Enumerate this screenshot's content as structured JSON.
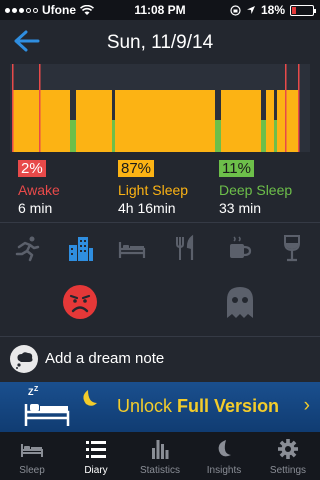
{
  "status_bar": {
    "carrier": "Ufone",
    "time": "11:08 PM",
    "battery": "18%",
    "battery_level": 0.18
  },
  "header": {
    "title": "Sun, 11/9/14",
    "back_icon": "back-arrow-icon"
  },
  "chart_data": {
    "type": "bar",
    "stages": [
      "Awake",
      "Light Sleep",
      "Deep Sleep"
    ],
    "colors": {
      "awake": "#e84a4a",
      "light": "#fcb314",
      "deep": "#6dbf4a",
      "background": "#2b303a"
    }
  },
  "stats": [
    {
      "percent": "2%",
      "label": "Awake",
      "duration": "6 min",
      "color": "#e84a4a"
    },
    {
      "percent": "87%",
      "label": "Light Sleep",
      "duration": "4h 16min",
      "color": "#fcb314"
    },
    {
      "percent": "11%",
      "label": "Deep Sleep",
      "duration": "33 min",
      "color": "#6dbf4a"
    }
  ],
  "activity_icons": [
    "running-icon",
    "city-icon",
    "bed-icon",
    "meal-icon",
    "coffee-icon",
    "wine-icon"
  ],
  "mood": {
    "selected": "sad-face-icon",
    "other": "ghost-icon"
  },
  "dream_note": {
    "label": "Add a dream note"
  },
  "banner": {
    "text_normal": "Unlock ",
    "text_bold": "Full Version",
    "chevron": "›"
  },
  "tabs": [
    {
      "label": "Sleep",
      "icon": "bed-icon",
      "active": false
    },
    {
      "label": "Diary",
      "icon": "list-icon",
      "active": true
    },
    {
      "label": "Statistics",
      "icon": "bar-chart-icon",
      "active": false
    },
    {
      "label": "Insights",
      "icon": "moon-icon",
      "active": false
    },
    {
      "label": "Settings",
      "icon": "gear-icon",
      "active": false
    }
  ],
  "accent": "#2f8ee0"
}
